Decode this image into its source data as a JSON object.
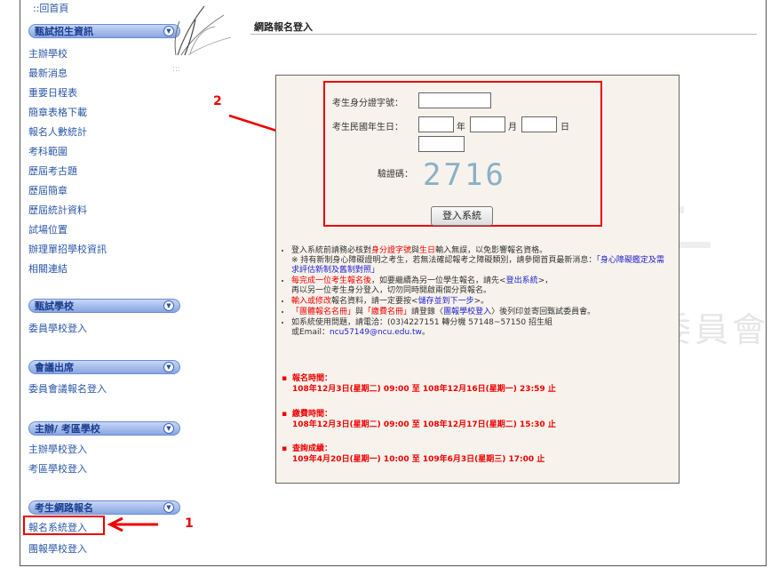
{
  "sidebar": {
    "home": "::回首頁",
    "dots": ":::",
    "section1": {
      "title": "甄試招生資訊",
      "items": [
        "主辦學校",
        "最新消息",
        "重要日程表",
        "簡章表格下載",
        "報名人數統計",
        "考科範圍",
        "歷屆考古題",
        "歷屆簡章",
        "歷屆統計資料",
        "試場位置",
        "辦理單招學校資訊",
        "相關連結"
      ]
    },
    "section2": {
      "title": "甄試學校",
      "items": [
        "委員學校登入"
      ]
    },
    "section3": {
      "title": "會議出席",
      "items": [
        "委員會議報名登入"
      ]
    },
    "section4": {
      "title": "主辦/ 考區學校",
      "items": [
        "主辦學校登入",
        "考區學校登入"
      ]
    },
    "section5": {
      "title": "考生網路報名",
      "items": [
        "報名系統登入",
        "團報學校登入"
      ]
    }
  },
  "page_title": "網路報名登入",
  "form": {
    "id_label": "考生身分證字號：",
    "dob_label": "考生民國年生日：",
    "year_unit": "年",
    "month_unit": "月",
    "day_unit": "日",
    "captcha_label": "驗證碼：",
    "captcha_text": "2716",
    "submit_label": "登入系統"
  },
  "notes": {
    "n1a": "登入系統前請務必核對",
    "n1b": "身分證字號",
    "n1c": "與",
    "n1d": "生日",
    "n1e": "輸入無誤，以免影響報名資格。",
    "n1f": "※ 持有新制身心障礙證明之考生，若無法確認報考之障礙類別，請參閱首頁最新消息：",
    "n1g": "「身心障礙鑑定及需求評估新制及舊制對照」",
    "n2a": "每完成一位考生報名後",
    "n2b": "，如要繼續為另一位學生報名，請先<",
    "n2c": "登出系統",
    "n2d": ">，",
    "n2e": "再以另一位考生身分登入，切勿同時開啟兩個分頁報名。",
    "n3a": "輸入或修改",
    "n3b": "報名資料，請一定要按<",
    "n3c": "儲存並到下一步",
    "n3d": ">。",
    "n4a": "「團體報名名冊」",
    "n4b": "與",
    "n4c": "「繳費名冊」",
    "n4d": "請登錄〈",
    "n4e": "團報學校登入",
    "n4f": "〉後列印並寄回甄試委員會。",
    "n5a": "如系統使用問題，請電洽：(03)4227151 轉分機 57148~57150 招生組",
    "n5b": "或Email：",
    "n5c": "ncu57149@ncu.edu.tw",
    "n5d": "。"
  },
  "schedule": [
    {
      "title": "報名時間：",
      "detail": "108年12月3日(星期二) 09:00 至 108年12月16日(星期一) 23:59 止"
    },
    {
      "title": "繳費時間：",
      "detail": "108年12月3日(星期二) 09:00 至 108年12月17日(星期二) 15:30 止"
    },
    {
      "title": "查詢成績：",
      "detail": "109年4月20日(星期一) 10:00 至 109年6月3日(星期三) 17:00 止"
    }
  ],
  "annotations": {
    "step1": "1",
    "step2": "2"
  },
  "watermark": "委員會",
  "colors": {
    "highlight_red": "#e00000",
    "link_blue": "#2a56a8",
    "header_blue": "#88a6e3"
  }
}
